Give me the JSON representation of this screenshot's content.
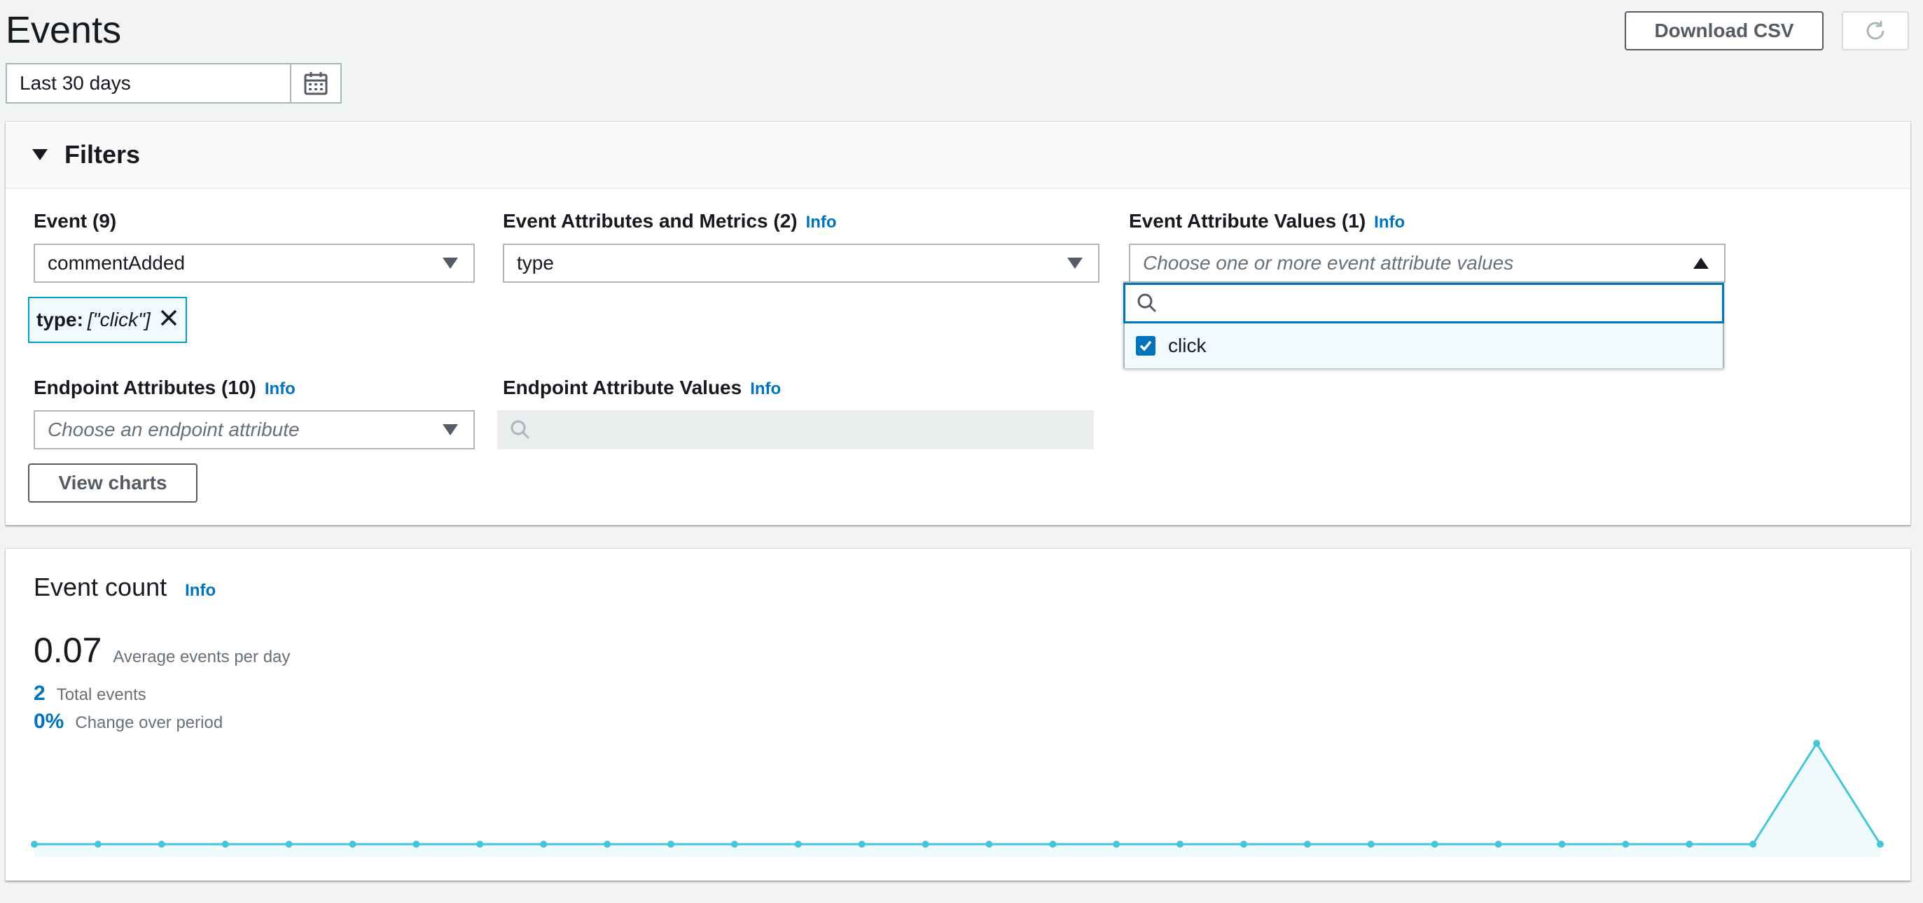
{
  "page": {
    "title": "Events"
  },
  "toolbar": {
    "download_label": "Download CSV"
  },
  "date_range": {
    "value": "Last 30 days"
  },
  "filters": {
    "title": "Filters",
    "event": {
      "label": "Event (9)",
      "value": "commentAdded"
    },
    "event_attributes": {
      "label": "Event Attributes and Metrics (2)",
      "info": "Info",
      "value": "type"
    },
    "event_attribute_values": {
      "label": "Event Attribute Values (1)",
      "info": "Info",
      "placeholder": "Choose one or more event attribute values",
      "search_value": "",
      "options": [
        {
          "label": "click",
          "checked": true
        }
      ]
    },
    "token": {
      "key": "type:",
      "value": "[\"click\"]"
    },
    "endpoint_attributes": {
      "label": "Endpoint Attributes (10)",
      "info": "Info",
      "placeholder": "Choose an endpoint attribute"
    },
    "endpoint_attribute_values": {
      "label": "Endpoint Attribute Values",
      "info": "Info"
    },
    "view_charts_label": "View charts"
  },
  "event_count": {
    "title": "Event count",
    "info": "Info",
    "average": {
      "value": "0.07",
      "label": "Average events per day"
    },
    "total": {
      "value": "2",
      "label": "Total events"
    },
    "change": {
      "value": "0%",
      "label": "Change over period"
    }
  },
  "colors": {
    "accent": "#0073bb",
    "chart_line": "#44c5d8",
    "chart_fill": "#eefafc"
  },
  "chart_data": {
    "type": "area",
    "x": [
      1,
      2,
      3,
      4,
      5,
      6,
      7,
      8,
      9,
      10,
      11,
      12,
      13,
      14,
      15,
      16,
      17,
      18,
      19,
      20,
      21,
      22,
      23,
      24,
      25,
      26,
      27,
      28,
      29,
      30
    ],
    "values": [
      0,
      0,
      0,
      0,
      0,
      0,
      0,
      0,
      0,
      0,
      0,
      0,
      0,
      0,
      0,
      0,
      0,
      0,
      0,
      0,
      0,
      0,
      0,
      0,
      0,
      0,
      0,
      0,
      2,
      0
    ],
    "ylim": [
      0,
      2
    ],
    "grid": false,
    "legend": "none"
  }
}
